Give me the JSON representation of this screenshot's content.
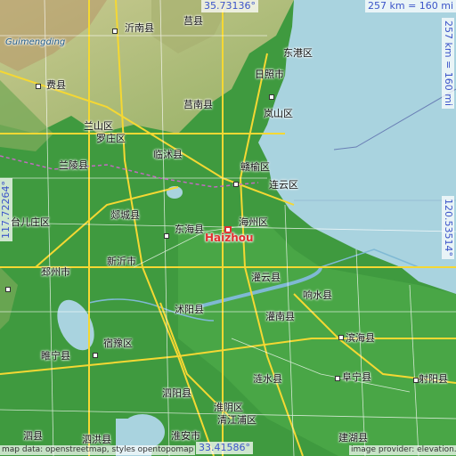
{
  "coords": {
    "top": "35.73136°",
    "bottom": "33.41586°",
    "left": "117.72264°",
    "right": "120.53514°",
    "scale_top": "257 km = 160 mi",
    "scale_right": "257 km = 160 mi"
  },
  "target_city": "Haizhou",
  "places": [
    {
      "name": "Guimengding"
    },
    {
      "name": "沂南县"
    },
    {
      "name": "莒县"
    },
    {
      "name": "东港区"
    },
    {
      "name": "日照市"
    },
    {
      "name": "费县"
    },
    {
      "name": "兰山区"
    },
    {
      "name": "罗庄区"
    },
    {
      "name": "莒南县"
    },
    {
      "name": "岚山区"
    },
    {
      "name": "临沭县"
    },
    {
      "name": "兰陵县"
    },
    {
      "name": "赣榆区"
    },
    {
      "name": "连云区"
    },
    {
      "name": "郯城县"
    },
    {
      "name": "海州区"
    },
    {
      "name": "东海县"
    },
    {
      "name": "新沂市"
    },
    {
      "name": "邳州市"
    },
    {
      "name": "灌云县"
    },
    {
      "name": "响水县"
    },
    {
      "name": "沭阳县"
    },
    {
      "name": "灌南县"
    },
    {
      "name": "滨海县"
    },
    {
      "name": "宿豫区"
    },
    {
      "name": "睢宁县"
    },
    {
      "name": "涟水县"
    },
    {
      "name": "阜宁县"
    },
    {
      "name": "射阳县"
    },
    {
      "name": "泗阳县"
    },
    {
      "name": "淮阴区"
    },
    {
      "name": "淮安市"
    },
    {
      "name": "建湖县"
    },
    {
      "name": "泗洪县"
    },
    {
      "name": "泗县"
    },
    {
      "name": "台儿庄区"
    },
    {
      "name": "淮阴区"
    },
    {
      "name": "清江浦区"
    }
  ],
  "attribution_left": "map data: openstreetmap, styles opentopomap",
  "attribution_right": "image provider: elevation.city",
  "colors": {
    "sea": "#a9d3df",
    "lowland": "#3f9a3f",
    "hills": "#c8c08a",
    "roads_major": "#f5d833",
    "roads_minor": "#ffffff",
    "target": "#e03030",
    "coord_text": "#3b54c9"
  }
}
